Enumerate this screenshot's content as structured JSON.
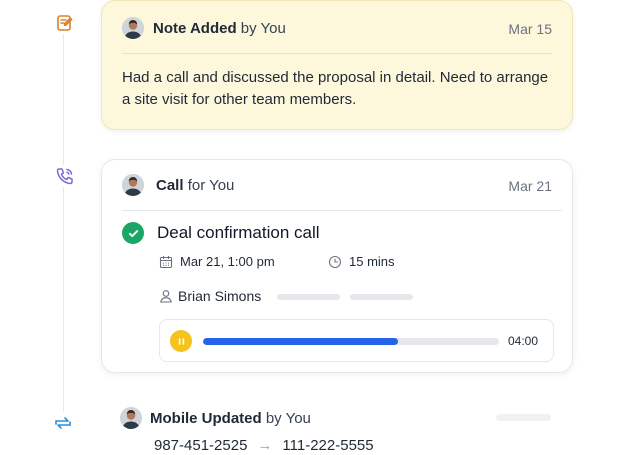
{
  "note": {
    "title": "Note Added",
    "by": "by You",
    "date": "Mar 15",
    "body": "Had a call and discussed the proposal in detail. Need to arrange a site visit for other team members."
  },
  "call": {
    "title": "Call",
    "by": "for You",
    "date": "Mar 21",
    "subject": "Deal confirmation call",
    "datetime": "Mar 21, 1:00 pm",
    "duration": "15 mins",
    "contact": "Brian Simons",
    "audio": {
      "progress": 0.66,
      "length": "04:00"
    }
  },
  "mobile": {
    "title": "Mobile Updated",
    "by": "by You",
    "old_number": "987-451-2525",
    "arrow": "→",
    "new_number": "111-222-5555"
  },
  "colors": {
    "note_icon": "#d9822b",
    "call_icon": "#7c6bd6",
    "update_icon": "#2b8fd9",
    "note_bg": "#fdf7dc",
    "success": "#1aa765",
    "progress": "#2563eb",
    "play": "#f6c21c"
  },
  "icons": {
    "note": "edit-note-icon",
    "call": "phone-call-icon",
    "update": "sync-icon",
    "completed": "check-circle-icon",
    "calendar": "calendar-icon",
    "clock": "clock-icon",
    "user": "user-icon",
    "pause": "pause-icon"
  }
}
